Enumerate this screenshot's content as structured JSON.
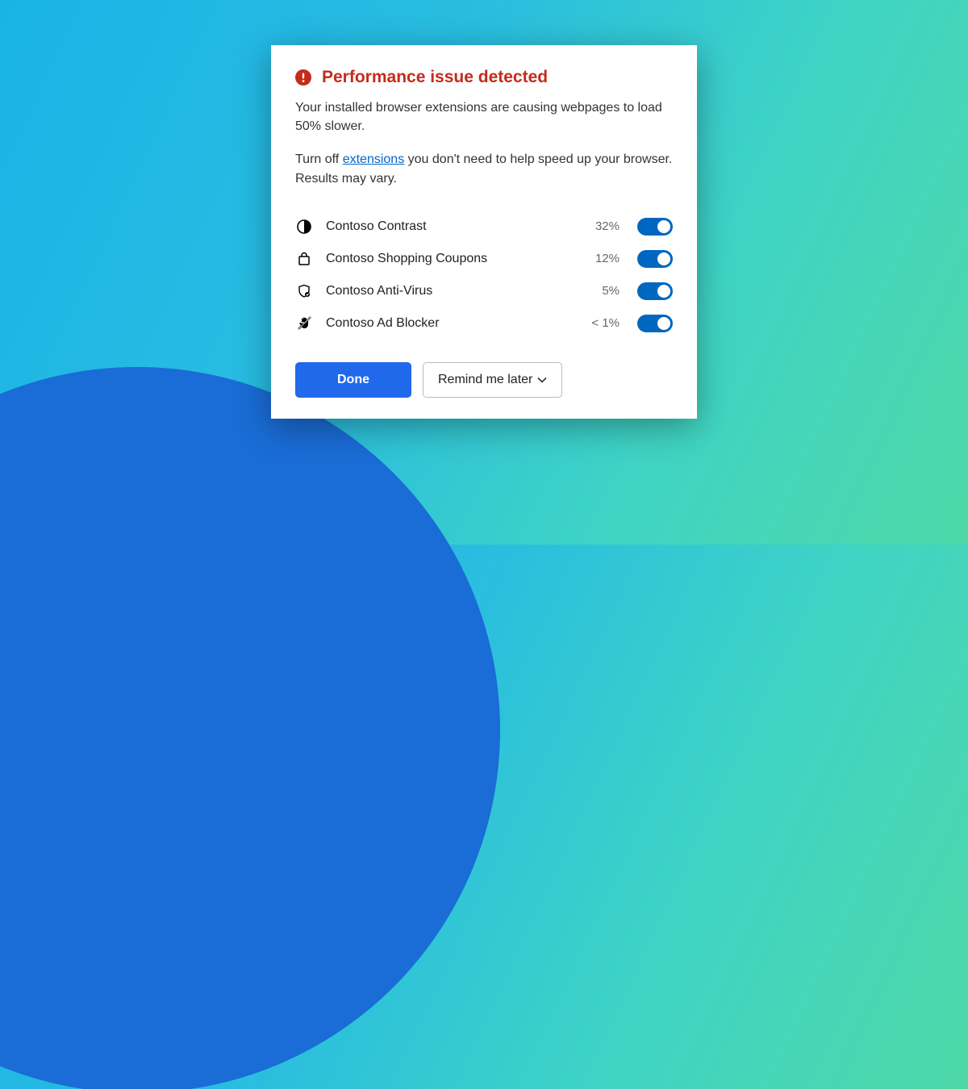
{
  "dialog": {
    "title": "Performance issue detected",
    "message1": "Your installed browser extensions are causing webpages to load 50% slower.",
    "message2_before": "Turn off ",
    "message2_link": "extensions",
    "message2_after": " you don't need to help speed up your browser. Results may vary."
  },
  "extensions": [
    {
      "name": "Contoso Contrast",
      "impact": "32%",
      "enabled": true,
      "icon": "contrast-icon"
    },
    {
      "name": "Contoso Shopping Coupons",
      "impact": "12%",
      "enabled": true,
      "icon": "shopping-icon"
    },
    {
      "name": "Contoso Anti-Virus",
      "impact": "5%",
      "enabled": true,
      "icon": "shield-icon"
    },
    {
      "name": "Contoso Ad Blocker",
      "impact": "< 1%",
      "enabled": true,
      "icon": "hand-icon"
    }
  ],
  "buttons": {
    "done": "Done",
    "remind": "Remind me later"
  },
  "colors": {
    "alert": "#c42b1c",
    "primary": "#2169eb",
    "toggle": "#0067c0",
    "link": "#0066cc"
  }
}
